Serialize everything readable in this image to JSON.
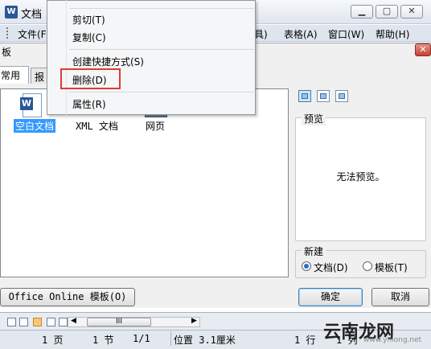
{
  "window": {
    "app_icon": "W",
    "title": "文档",
    "min": "▁",
    "max": "▢",
    "close": "✕"
  },
  "menubar": {
    "items": [
      {
        "label": "文件(F)"
      },
      {
        "label": "具)"
      },
      {
        "label": "表格(A)"
      },
      {
        "label": "窗口(W)"
      },
      {
        "label": "帮助(H)"
      }
    ]
  },
  "dialog": {
    "title": "板",
    "close": "✕",
    "tabs": [
      {
        "label": "常用"
      },
      {
        "label": "报"
      }
    ],
    "templates": [
      {
        "label": "空白文档"
      },
      {
        "label": "XML 文档"
      },
      {
        "label": "网页"
      }
    ],
    "preview_legend": "预览",
    "preview_message": "无法预览。",
    "new_legend": "新建",
    "radio_doc": "文档(D)",
    "radio_tpl": "模板(T)",
    "office_button": "Office Online 模板(O)",
    "ok": "确定",
    "cancel": "取消"
  },
  "context_menu": {
    "items": [
      {
        "label": "剪切(T)"
      },
      {
        "label": "复制(C)"
      },
      {
        "label": "创建快捷方式(S)"
      },
      {
        "label": "删除(D)"
      },
      {
        "label": "属性(R)"
      }
    ]
  },
  "scroll": {
    "thumb": "III"
  },
  "status": {
    "page": "1 页",
    "section": "1 节",
    "pages": "1/1",
    "position": "位置 3.1厘米",
    "line": "1 行",
    "col": "1 列"
  },
  "watermark": {
    "text": "云南龙网",
    "sub": "www.ynlong.net"
  },
  "colors": {
    "highlight_box": "#e03a3a",
    "selection": "#3399ff"
  }
}
